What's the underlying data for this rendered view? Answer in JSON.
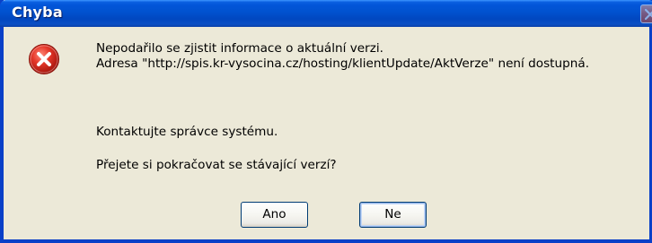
{
  "dialog": {
    "title": "Chyba",
    "icon": "error-icon",
    "message_lines": [
      "Nepodařilo se zjistit informace o aktuální verzi.",
      "Adresa \"http://spis.kr-vysocina.cz/hosting/klientUpdate/AktVerze\" není dostupná."
    ],
    "contact": "Kontaktujte správce systému.",
    "question": "Přejete si pokračovat se stávající verzí?",
    "buttons": {
      "yes": "Ano",
      "no": "Ne"
    }
  },
  "colors": {
    "titlebar": "#0152cf",
    "frame": "#0a40c8",
    "dialog_bg": "#ece9d8",
    "error_red": "#d9261c"
  }
}
